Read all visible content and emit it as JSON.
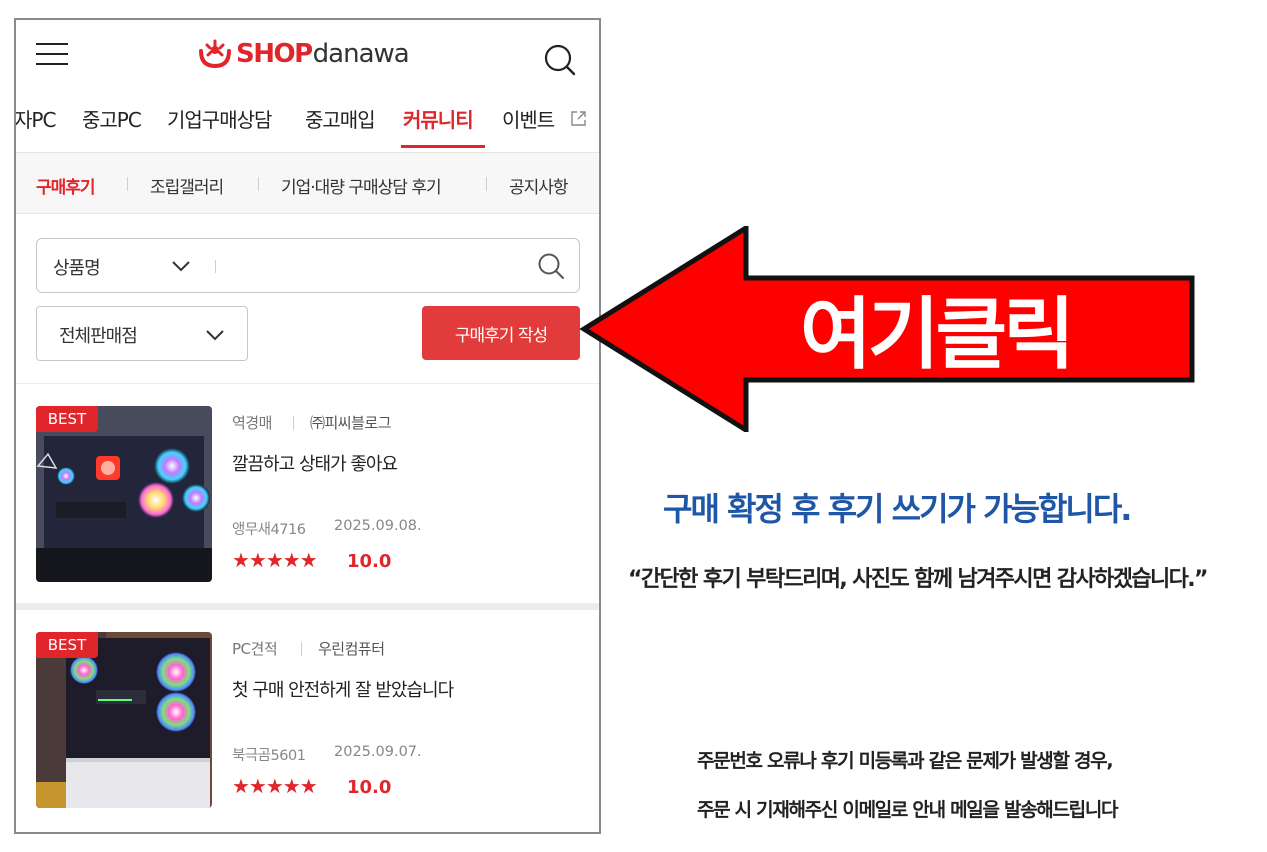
{
  "header": {
    "logo_shop": "SHOP",
    "logo_danawa": "danawa",
    "menu_icon": "hamburger-icon",
    "search_icon": "search-icon"
  },
  "gnb": {
    "items": [
      "자PC",
      "중고PC",
      "기업구매상담",
      "중고매입",
      "커뮤니티",
      "이벤트"
    ],
    "active": "커뮤니티",
    "external_icon": "external-link-icon"
  },
  "subnav": {
    "items": [
      "구매후기",
      "조립갤러리",
      "기업·대량 구매상담 후기",
      "공지사항"
    ],
    "active": "구매후기"
  },
  "search": {
    "type_label": "상품명",
    "placeholder": "",
    "store_select": "전체판매점",
    "write_button": "구매후기 작성"
  },
  "reviews": [
    {
      "badge": "BEST",
      "category": "역경매",
      "seller": "㈜피씨블로그",
      "title": "깔끔하고 상태가 좋아요",
      "author": "앵무새4716",
      "date": "2025.09.08.",
      "stars": "★★★★★",
      "rating": "10.0"
    },
    {
      "badge": "BEST",
      "category": "PC견적",
      "seller": "우린컴퓨터",
      "title": "첫 구매 안전하게 잘 받았습니다",
      "author": "북극곰5601",
      "date": "2025.09.07.",
      "stars": "★★★★★",
      "rating": "10.0"
    }
  ],
  "annotation": {
    "arrow_label": "여기클릭",
    "main_notice": "구매 확정 후 후기 쓰기가 가능합니다.",
    "quote": "“간단한 후기 부탁드리며, 사진도 함께 남겨주시면 감사하겠습니다.”",
    "line1": "주문번호 오류나 후기 미등록과 같은 문제가 발생할 경우,",
    "line2": "주문 시 기재해주신 이메일로 안내 메일을 발송해드립니다"
  },
  "colors": {
    "brand_red": "#e0262b",
    "button_red": "#e23b3b",
    "notice_blue": "#1f57a8",
    "arrow_red": "#ff0000"
  }
}
